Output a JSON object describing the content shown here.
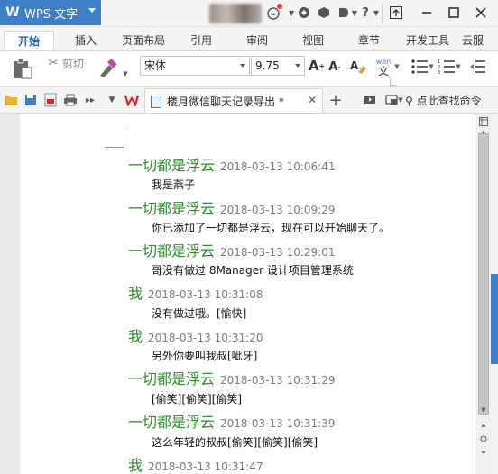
{
  "app": {
    "name": "WPS 文字",
    "logo_letter": "W"
  },
  "menu": {
    "tabs": [
      "开始",
      "插入",
      "页面布局",
      "引用",
      "审阅",
      "视图",
      "章节",
      "开发工具",
      "云服"
    ],
    "active": 0
  },
  "ribbon": {
    "cut_label": "剪切",
    "font_name": "宋体",
    "font_size": "9.75",
    "wen_label": "wén\n文"
  },
  "document": {
    "tab_title": "楼月微信聊天记录导出 *",
    "search_cmd": "点此查找命令"
  },
  "messages": [
    {
      "sender": "一切都是浮云",
      "time": "2018-03-13 10:06:41",
      "text": "我是燕子"
    },
    {
      "sender": "一切都是浮云",
      "time": "2018-03-13 10:09:29",
      "text": "你已添加了一切都是浮云，现在可以开始聊天了。"
    },
    {
      "sender": "一切都是浮云",
      "time": "2018-03-13 10:29:01",
      "text": "哥没有做过 8Manager 设计项目管理系统"
    },
    {
      "sender": "我",
      "time": "2018-03-13 10:31:08",
      "text": "没有做过哦。[愉快]"
    },
    {
      "sender": "我",
      "time": "2018-03-13 10:31:20",
      "text": "另外你要叫我叔[呲牙]"
    },
    {
      "sender": "一切都是浮云",
      "time": "2018-03-13 10:31:29",
      "text": "[偷笑][偷笑][偷笑]"
    },
    {
      "sender": "一切都是浮云",
      "time": "2018-03-13 10:31:39",
      "text": "这么年轻的叔叔[偷笑][偷笑][偷笑]"
    },
    {
      "sender": "我",
      "time": "2018-03-13 10:31:47",
      "text": ""
    }
  ],
  "colors": {
    "brand": "#3d7ec7",
    "sender": "#2e8b2e",
    "timestamp": "#7c7c7c",
    "wps_red": "#d9232d"
  }
}
